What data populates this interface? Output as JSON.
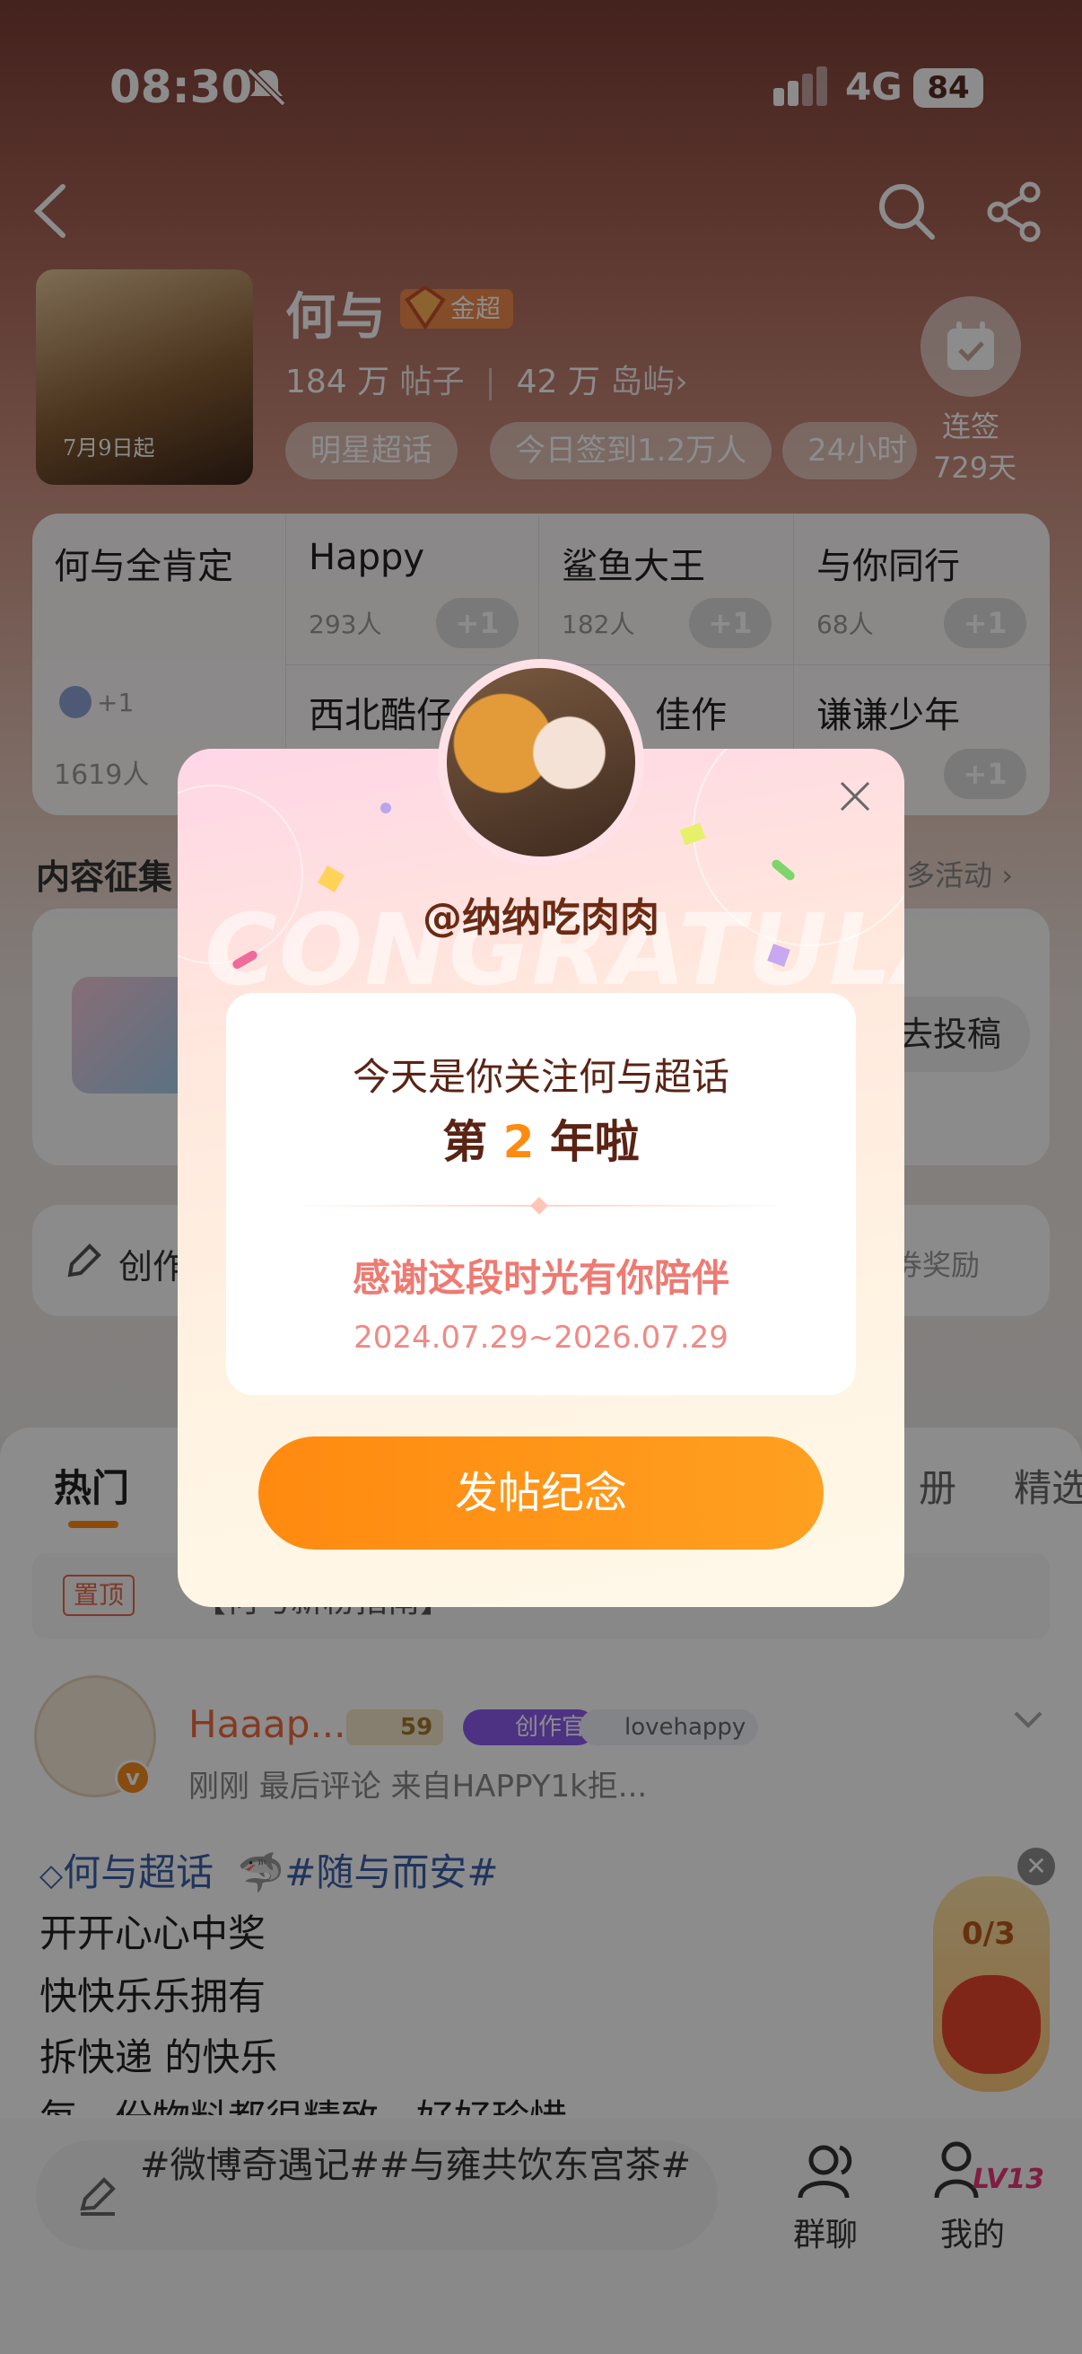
{
  "status_bar": {
    "time": "08:30",
    "network": "4G",
    "battery": "84"
  },
  "community": {
    "name": "何与",
    "badge": "金超",
    "posts_count": "184 万",
    "posts_label": "帖子",
    "islands_count": "42 万",
    "islands_label": "岛屿",
    "poster_caption": "7月9日起",
    "checkin_title": "连签",
    "checkin_days": "729天",
    "tags": [
      "明星超话",
      "今日签到1.2万人",
      "24小时"
    ]
  },
  "groups": [
    {
      "name": "何与全肯定",
      "count": "1619人"
    },
    {
      "name": "Happy",
      "count": "293人",
      "action": "+1"
    },
    {
      "name": "鲨鱼大王",
      "count": "182人",
      "action": "+1"
    },
    {
      "name": "与你同行",
      "count": "68人",
      "action": "+1"
    },
    {
      "name": "西北酷仔",
      "count": "",
      "action": "+1"
    },
    {
      "name": "佳作",
      "count": "",
      "action": "+1"
    },
    {
      "name": "谦谦少年",
      "count": "",
      "action": "+1"
    }
  ],
  "member_avatar_plus": "+1",
  "section": {
    "title": "内容征集",
    "more": "多活动",
    "submit": "去投稿",
    "creator": "创作",
    "reward": "券奖励"
  },
  "tabs": [
    "热门",
    "册",
    "精选"
  ],
  "pinned": {
    "tag": "置顶",
    "text": "【何与新粉指南】"
  },
  "post": {
    "author": "Haaap...",
    "level": "59",
    "creator_tag": "创作官",
    "group": "lovehappy",
    "meta": "刚刚 最后评论  来自HAPPY1k拒...",
    "topic_super": "何与超话",
    "topic_tag": "#随与而安#",
    "lines": [
      "开开心心中奖",
      "快快乐乐拥有",
      "拆快递 的快乐",
      "每一份物料都很精致，好好珍惜"
    ]
  },
  "task": {
    "progress": "0/3"
  },
  "bottom": {
    "compose_text": "#微博奇遇记##与雍共饮东宫茶#",
    "group_chat": "群聊",
    "mine": "我的",
    "level": "LV13"
  },
  "modal": {
    "username": "@纳纳吃肉肉",
    "line1": "今天是你关注何与超话",
    "line2_prefix": "第",
    "line2_num": "2",
    "line2_suffix": "年啦",
    "thanks": "感谢这段时光有你陪伴",
    "date_range": "2024.07.29~2026.07.29",
    "button": "发帖纪念",
    "bg_word": "CONGRATULATE"
  },
  "colors": {
    "accent": "#ff8a10",
    "brand_red": "#f06a3f",
    "thanks": "#ee7a72"
  }
}
